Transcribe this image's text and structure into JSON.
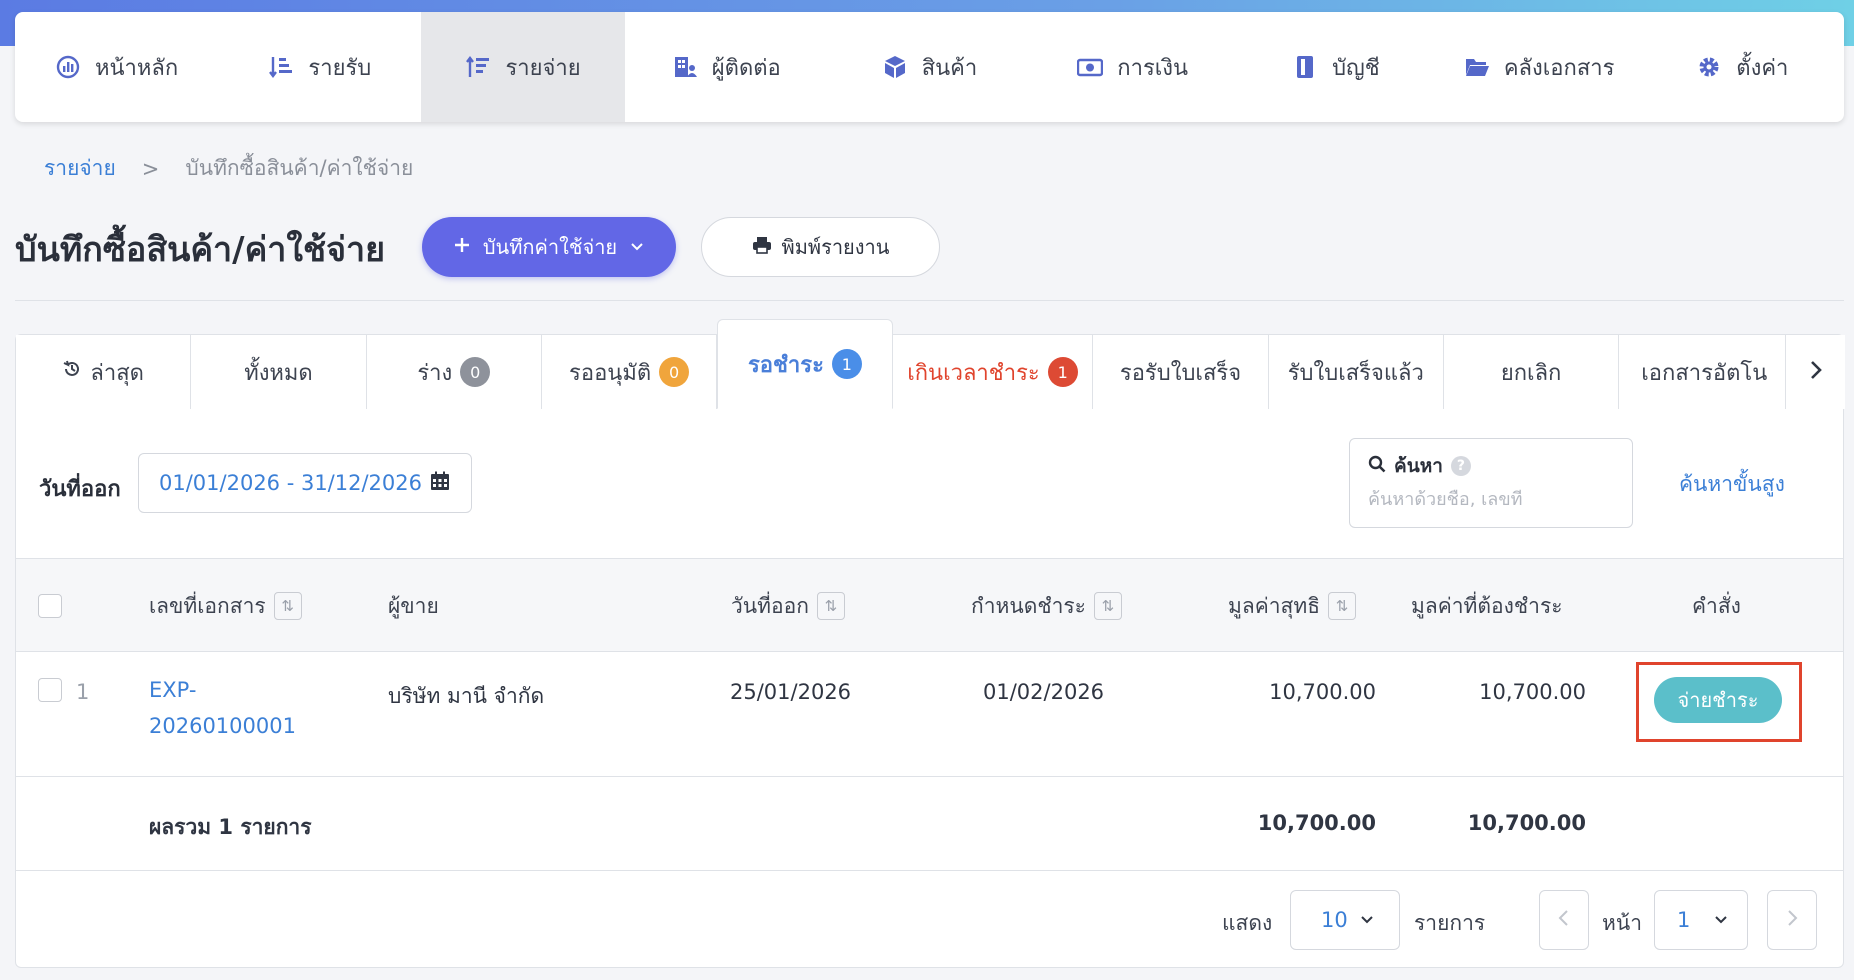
{
  "nav": {
    "items": [
      {
        "label": "หน้าหลัก",
        "icon": "dashboard-icon"
      },
      {
        "label": "รายรับ",
        "icon": "income-sort-icon"
      },
      {
        "label": "รายจ่าย",
        "icon": "expense-sort-icon"
      },
      {
        "label": "ผู้ติดต่อ",
        "icon": "contacts-building-icon"
      },
      {
        "label": "สินค้า",
        "icon": "product-box-icon"
      },
      {
        "label": "การเงิน",
        "icon": "money-bill-icon"
      },
      {
        "label": "บัญชี",
        "icon": "ledger-book-icon"
      },
      {
        "label": "คลังเอกสาร",
        "icon": "folder-open-icon"
      },
      {
        "label": "ตั้งค่า",
        "icon": "gear-icon"
      }
    ],
    "active_index": 2
  },
  "breadcrumb": {
    "parent": "รายจ่าย",
    "separator": ">",
    "current": "บันทึกซื้อสินค้า/ค่าใช้จ่าย"
  },
  "header": {
    "title": "บันทึกซื้อสินค้า/ค่าใช้จ่าย",
    "primary_button": "บันทึกค่าใช้จ่าย",
    "print_button": "พิมพ์รายงาน"
  },
  "tabs": {
    "latest": "ล่าสุด",
    "all": "ทั้งหมด",
    "draft": "ร่าง",
    "draft_count": "0",
    "pending_approval": "รออนุมัติ",
    "pending_approval_count": "0",
    "awaiting_payment": "รอชำระ",
    "awaiting_payment_count": "1",
    "overdue": "เกินเวลาชำระ",
    "overdue_count": "1",
    "awaiting_receipt": "รอรับใบเสร็จ",
    "receipt_received": "รับใบเสร็จแล้ว",
    "cancelled": "ยกเลิก",
    "auto_docs": "เอกสารอัตโน"
  },
  "filters": {
    "date_label": "วันที่ออก",
    "date_range": "01/01/2026 - 31/12/2026",
    "search_label": "ค้นหา",
    "search_help": "?",
    "search_placeholder": "ค้นหาด้วยชื่อ, เลขที่",
    "search_value": "",
    "advanced_search": "ค้นหาขั้นสูง"
  },
  "table": {
    "columns": {
      "doc_no": "เลขที่เอกสาร",
      "vendor": "ผู้ขาย",
      "issue_date": "วันที่ออก",
      "due_date": "กำหนดชำระ",
      "net_value": "มูลค่าสุทธิ",
      "amount_due": "มูลค่าที่ต้องชำระ",
      "actions": "คำสั่ง"
    },
    "rows": [
      {
        "index": "1",
        "doc_no_line1": "EXP-",
        "doc_no_line2": "20260100001",
        "vendor": "บริษัท มานี จำกัด",
        "issue_date": "25/01/2026",
        "due_date": "01/02/2026",
        "net_value": "10,700.00",
        "amount_due": "10,700.00",
        "action_label": "จ่ายชำระ"
      }
    ],
    "total": {
      "label": "ผลรวม 1 รายการ",
      "net_value": "10,700.00",
      "amount_due": "10,700.00"
    }
  },
  "pagination": {
    "show_label": "แสดง",
    "page_size": "10",
    "items_label": "รายการ",
    "page_label": "หน้า",
    "page": "1"
  },
  "colors": {
    "primary": "#6267e6",
    "link": "#3b7fd6",
    "pay_button": "#5bbfca",
    "overdue": "#e0442d",
    "highlight": "#e0442d"
  }
}
